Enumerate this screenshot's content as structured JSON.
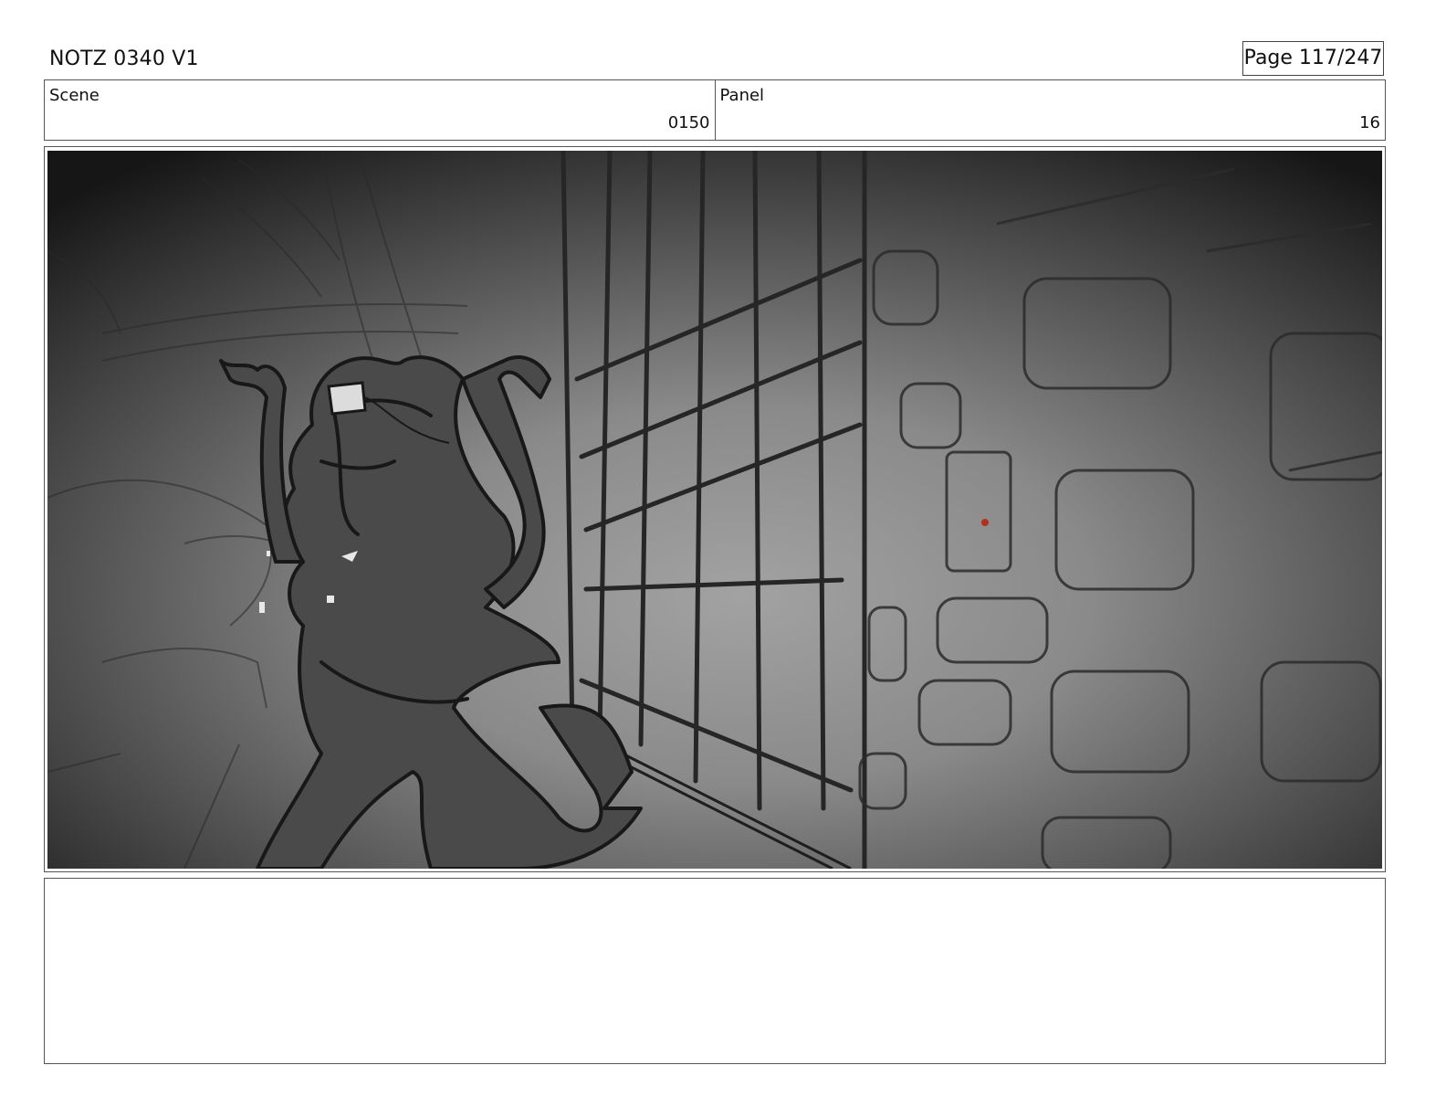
{
  "header": {
    "title": "NOTZ 0340 V1",
    "page": "Page 117/247"
  },
  "info": {
    "scene_label": "Scene",
    "scene_value": "0150",
    "panel_label": "Panel",
    "panel_value": "16"
  },
  "frame": {
    "image": "storyboard-sketch-creature-at-bars",
    "palette": {
      "light": "#9c9c9c",
      "dark": "#151515",
      "ink": "#222222",
      "creature": "#4a4a4a",
      "accent": "#b03020"
    }
  },
  "notes": {
    "text": ""
  }
}
